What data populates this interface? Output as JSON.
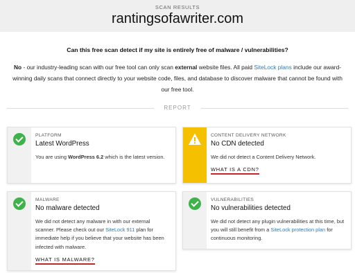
{
  "header": {
    "kicker": "SCAN RESULTS",
    "site": "rantingsofawriter.com"
  },
  "question": "Can this free scan detect if my site is entirely free of malware / vulnerabilities?",
  "answer": {
    "no": "No",
    "part1": " - our industry-leading scan with our free tool can only scan ",
    "external": "external",
    "part2": " website files. All paid ",
    "link": "SiteLock plans",
    "part3": " include our award-winning daily scans that connect directly to your website code, files, and database to discover malware that cannot be found with our free tool."
  },
  "divider_label": "REPORT",
  "cards": {
    "platform": {
      "status": "ok",
      "category": "PLATFORM",
      "title": "Latest WordPress",
      "desc1": "You are using ",
      "desc_bold": "WordPress 6.2",
      "desc2": " which is the latest version."
    },
    "cdn": {
      "status": "warning",
      "category": "CONTENT DELIVERY NETWORK",
      "title": "No CDN detected",
      "desc": "We did not detect a Content Delivery Network.",
      "more": "WHAT IS A CDN?"
    },
    "malware": {
      "status": "ok",
      "category": "MALWARE",
      "title": "No malware detected",
      "desc1": "We did not detect any malware in with our external scanner. Please check out our ",
      "link": "SiteLock 911",
      "desc2": " plan for immediate help if you believe that your website has been infected with malware.",
      "more": "WHAT IS MALWARE?"
    },
    "vuln": {
      "status": "ok",
      "category": "VULNERABILITIES",
      "title": "No vulnerabilities detected",
      "desc1": "We did not detect any plugin vulnerabilities at this time, but you will still benefit from a ",
      "link": "SiteLock protection plan",
      "desc2": " for continuous monitoring."
    }
  },
  "colors": {
    "ok": "#3fb24b",
    "warning": "#f5c000",
    "link": "#2a7ab8",
    "underline": "#c0272d"
  }
}
